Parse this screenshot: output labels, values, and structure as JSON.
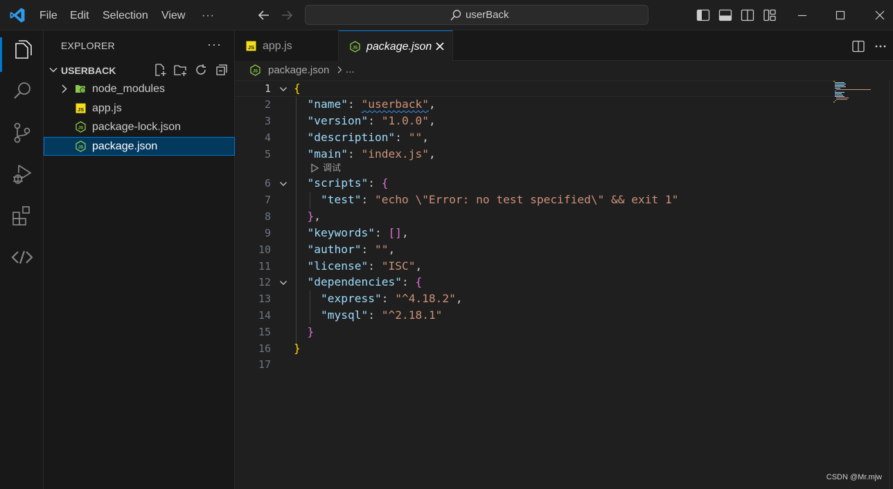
{
  "titlebar": {
    "menu": [
      "File",
      "Edit",
      "Selection",
      "View"
    ],
    "more": "···",
    "command_center": "userBack"
  },
  "sidebar": {
    "title": "EXPLORER",
    "more": "···",
    "section": "USERBACK",
    "items": [
      {
        "label": "node_modules",
        "icon": "folder-node-icon",
        "kind": "folder"
      },
      {
        "label": "app.js",
        "icon": "js-file-icon",
        "kind": "file"
      },
      {
        "label": "package-lock.json",
        "icon": "nodejs-file-icon",
        "kind": "file"
      },
      {
        "label": "package.json",
        "icon": "nodejs-file-icon",
        "kind": "file",
        "selected": true
      }
    ]
  },
  "tabs": [
    {
      "label": "app.js",
      "icon": "js-file-icon",
      "active": false
    },
    {
      "label": "package.json",
      "icon": "nodejs-file-icon",
      "active": true
    }
  ],
  "breadcrumb": {
    "file": "package.json",
    "more": "..."
  },
  "editor": {
    "codelens": "调试",
    "line_numbers": [
      "1",
      "2",
      "3",
      "4",
      "5",
      "6",
      "7",
      "8",
      "9",
      "10",
      "11",
      "12",
      "13",
      "14",
      "15",
      "16",
      "17"
    ],
    "lines": {
      "l2": {
        "key": "\"name\"",
        "val": "\"userback\""
      },
      "l3": {
        "key": "\"version\"",
        "val": "\"1.0.0\""
      },
      "l4": {
        "key": "\"description\"",
        "val": "\"\""
      },
      "l5": {
        "key": "\"main\"",
        "val": "\"index.js\""
      },
      "l6": {
        "key": "\"scripts\""
      },
      "l7": {
        "key": "\"test\"",
        "val": "\"echo \\\"Error: no test specified\\\" && exit 1\""
      },
      "l9": {
        "key": "\"keywords\"",
        "val": "[]"
      },
      "l10": {
        "key": "\"author\"",
        "val": "\"\""
      },
      "l11": {
        "key": "\"license\"",
        "val": "\"ISC\""
      },
      "l12": {
        "key": "\"dependencies\""
      },
      "l13": {
        "key": "\"express\"",
        "val": "\"^4.18.2\""
      },
      "l14": {
        "key": "\"mysql\"",
        "val": "\"^2.18.1\""
      }
    }
  },
  "colors": {
    "accent": "#0078d4",
    "key": "#9cdcfe",
    "string": "#ce9178",
    "bracket_1": "#ffd700",
    "bracket_2": "#da70d6",
    "node_green": "#8cc84b",
    "js_yellow": "#f5de19"
  },
  "watermark": "CSDN @Mr.mjw"
}
